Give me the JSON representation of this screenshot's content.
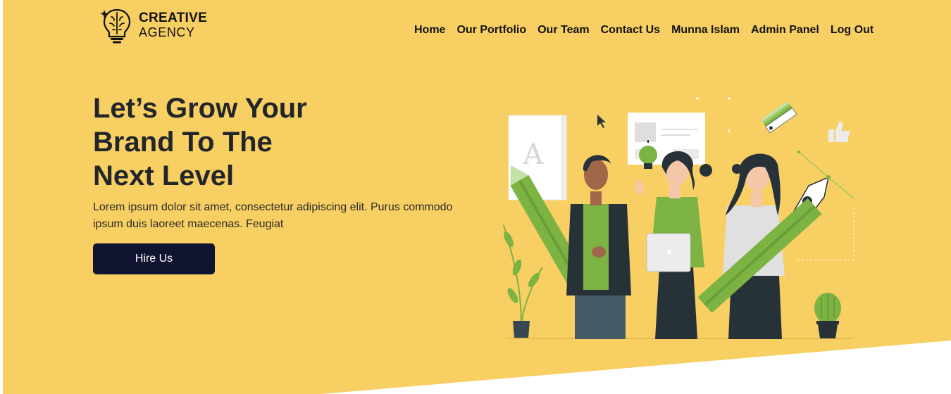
{
  "brand": {
    "name_line1": "CREATIVE",
    "name_line2": "AGENCY",
    "logo_icon": "brain-lightbulb-icon"
  },
  "nav": {
    "items": [
      {
        "label": "Home"
      },
      {
        "label": "Our Portfolio"
      },
      {
        "label": "Our Team"
      },
      {
        "label": "Contact Us"
      },
      {
        "label": "Munna Islam"
      },
      {
        "label": "Admin Panel"
      },
      {
        "label": "Log Out"
      }
    ]
  },
  "hero": {
    "headline_lines": [
      "Let’s Grow Your",
      "Brand To The",
      "Next Level"
    ],
    "description": "Lorem ipsum dolor sit amet, consectetur adipiscing elit. Purus commodo ipsum duis laoreet maecenas. Feugiat",
    "cta_label": "Hire Us",
    "illustration_icon": "creative-team-illustration"
  },
  "colors": {
    "background": "#f8cf62",
    "button": "#111430",
    "accent_green": "#7cb342",
    "heading": "#22262a"
  }
}
